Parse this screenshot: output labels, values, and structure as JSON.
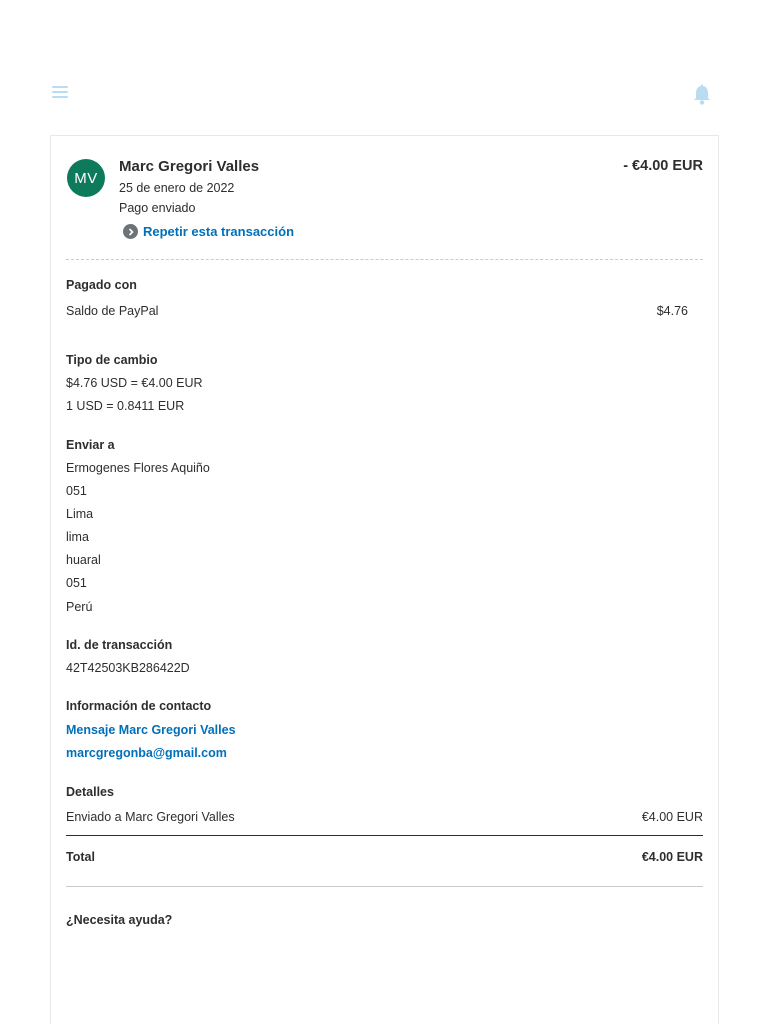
{
  "header": {
    "menu_icon": "hamburger-menu-icon",
    "notification_icon": "bell-icon",
    "icon_color": "#b9dcf2"
  },
  "transaction": {
    "avatar_initials": "MV",
    "avatar_color": "#0d7a5c",
    "merchant_name": "Marc Gregori Valles",
    "date": "25 de enero de 2022",
    "status": "Pago enviado",
    "repeat_label": "Repetir esta transacción",
    "amount": "- €4.00 EUR"
  },
  "paid_with": {
    "title": "Pagado con",
    "method": "Saldo de PayPal",
    "amount": "$4.76"
  },
  "exchange_rate": {
    "title": "Tipo de cambio",
    "line1": "$4.76 USD = €4.00 EUR",
    "line2": "1 USD = 0.8411 EUR"
  },
  "ship_to": {
    "title": "Enviar a",
    "lines": [
      "Ermogenes Flores Aquiño",
      "051",
      "Lima",
      "lima",
      "huaral",
      "051",
      "Perú"
    ]
  },
  "transaction_id": {
    "title": "Id. de transacción",
    "value": "42T42503KB286422D"
  },
  "contact": {
    "title": "Información de contacto",
    "message_link": "Mensaje Marc Gregori Valles",
    "email": "marcgregonba@gmail.com"
  },
  "details": {
    "title": "Detalles",
    "line_label": "Enviado a Marc Gregori Valles",
    "line_amount": "€4.00 EUR",
    "total_label": "Total",
    "total_amount": "€4.00 EUR"
  },
  "help": {
    "title": "¿Necesita ayuda?"
  },
  "colors": {
    "link": "#0070ba",
    "text": "#2c2e2f"
  }
}
